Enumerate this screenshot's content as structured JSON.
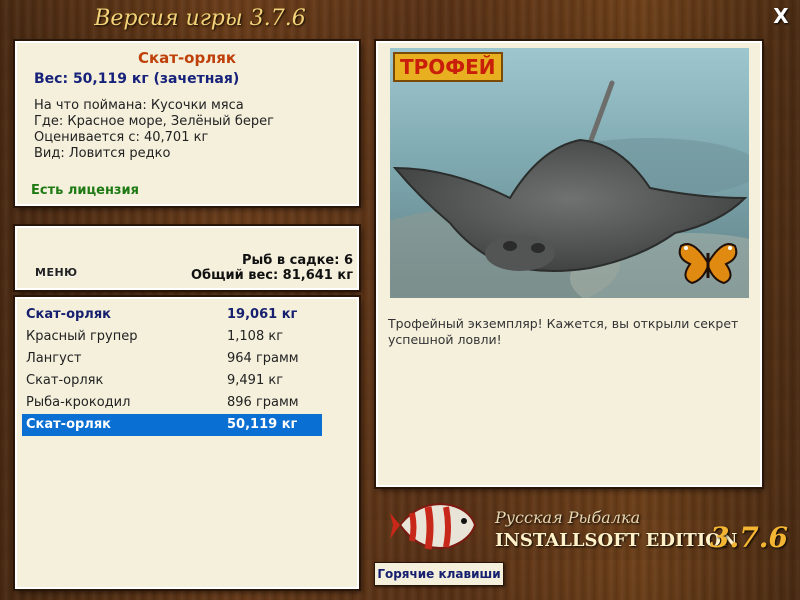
{
  "header": {
    "title": "Версия игры 3.7.6",
    "close_label": "X"
  },
  "catch_info": {
    "name": "Скат-орляк",
    "weight": "Вес: 50,119 кг (зачетная)",
    "bait": "На что поймана: Кусочки мяса",
    "location": "Где: Красное море, Зелёный берег",
    "rated_from": "Оценивается с: 40,701 кг",
    "species": "Вид: Ловится редко",
    "license": "Есть лицензия"
  },
  "cage": {
    "menu_label": "МЕНЮ",
    "count": "Рыб в садке: 6",
    "total_weight": "Общий вес: 81,641 кг"
  },
  "fish_list": [
    {
      "name": "Скат-орляк",
      "weight": "19,061 кг"
    },
    {
      "name": "Красный групер",
      "weight": "1,108 кг"
    },
    {
      "name": "Лангуст",
      "weight": "964 грамм"
    },
    {
      "name": "Скат-орляк",
      "weight": "9,491 кг"
    },
    {
      "name": "Рыба-крокодил",
      "weight": "896 грамм"
    },
    {
      "name": "Скат-орляк",
      "weight": "50,119 кг"
    }
  ],
  "photo": {
    "badge": "ТРОФЕЙ",
    "description": "Трофейный экземпляр! Кажется, вы открыли секрет успешной ловли!"
  },
  "logo": {
    "line1": "Русская Рыбалка",
    "line2": "INSTALLSOFT EDITION",
    "version": "3.7.6"
  },
  "footer": {
    "hotkeys_label": "Горячие клавиши"
  },
  "colors": {
    "accent": "#0a6fd2",
    "panel": "#f4f0dc",
    "title": "#f3d27a",
    "name": "#c0400a"
  }
}
